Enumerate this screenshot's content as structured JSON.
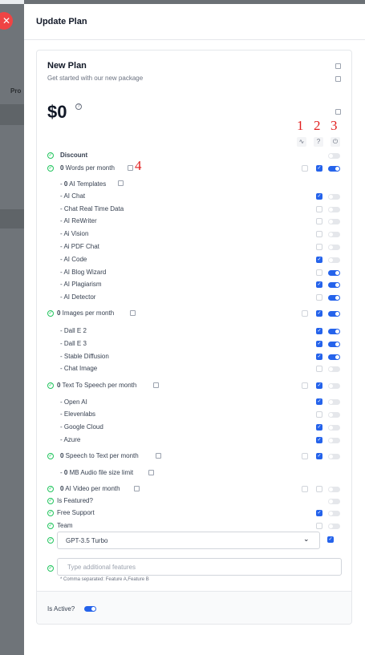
{
  "panel": {
    "title": "Update Plan",
    "close_glyph": "✕"
  },
  "background": {
    "fragment": "Pro"
  },
  "plan": {
    "name": "New Plan",
    "subtitle": "Get started with our new package",
    "price": "$0",
    "price_info": "?"
  },
  "annotations": [
    "1",
    "2",
    "3",
    "4"
  ],
  "features": {
    "discount": "Discount",
    "words": {
      "count": "0",
      "label": " Words per month"
    },
    "templates": {
      "prefix": "- ",
      "count": "0",
      "label": " AI Templates"
    },
    "words_items": [
      "- AI Chat",
      "- Chat Real Time Data",
      "- AI ReWriter",
      "- Ai Vision",
      "- Ai PDF Chat",
      "- AI Code",
      "- AI Blog Wizard",
      "- AI Plagiarism",
      "- AI Detector"
    ],
    "images": {
      "count": "0",
      "label": " Images per month"
    },
    "image_items": [
      "- Dall E 2",
      "- Dall E 3",
      "- Stable Diffusion",
      "- Chat Image"
    ],
    "tts": {
      "count": "0",
      "label": " Text To Speech per month"
    },
    "tts_items": [
      "- Open AI",
      "- Elevenlabs",
      "- Google Cloud",
      "- Azure"
    ],
    "stt": {
      "count": "0",
      "label": " Speech to Text per month"
    },
    "audio": {
      "prefix": "- ",
      "count": "0",
      "label": " MB Audio file size limit"
    },
    "video": {
      "count": "0",
      "label": " AI Video per month"
    },
    "featured": "Is Featured?",
    "support": "Free Support",
    "team": "Team"
  },
  "model_select": {
    "value": "GPT-3.5 Turbo"
  },
  "additional": {
    "placeholder": "Type additional features",
    "hint": "* Comma separated: Feature A,Feature B"
  },
  "footer": {
    "active_label": "Is Active?"
  },
  "colors": {
    "accent": "#2563eb",
    "check": "#22c55e",
    "danger": "#ef4444",
    "annotation": "#e11d1d"
  }
}
